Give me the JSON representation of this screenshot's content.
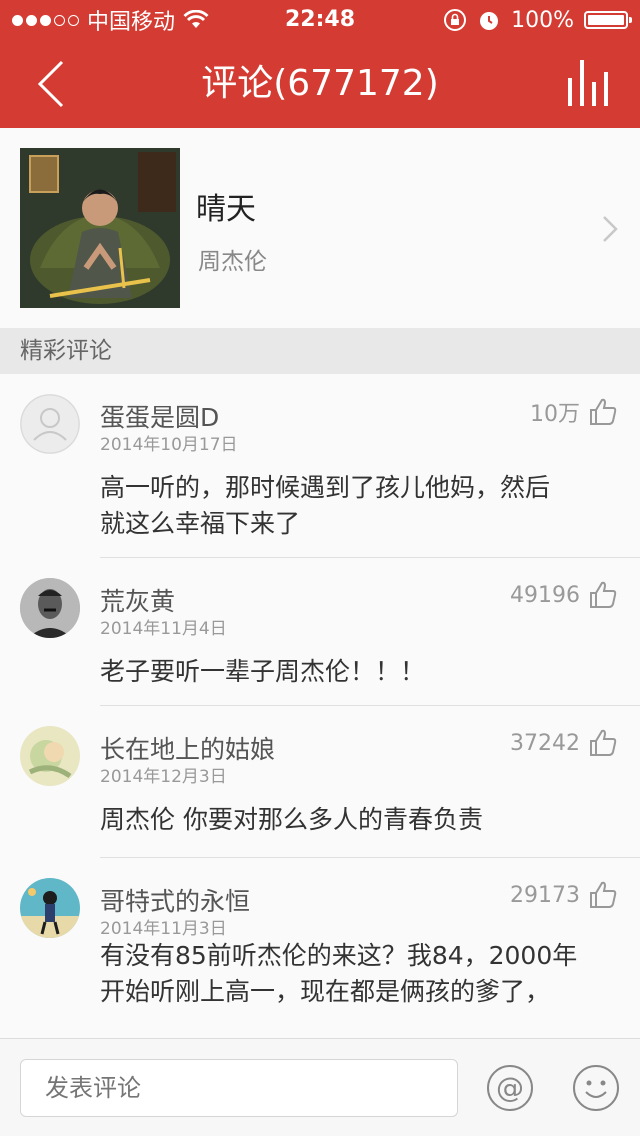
{
  "status_bar": {
    "carrier": "中国移动",
    "time": "22:48",
    "battery": "100%"
  },
  "nav": {
    "title": "评论(677172)"
  },
  "song": {
    "title": "晴天",
    "artist": "周杰伦"
  },
  "section": {
    "title": "精彩评论"
  },
  "comments": [
    {
      "user": "蛋蛋是圆D",
      "date": "2014年10月17日",
      "likes": "10万",
      "text_lines": [
        "高一听的，那时候遇到了孩儿他妈，然后",
        "就这么幸福下来了"
      ]
    },
    {
      "user": "荒灰黄",
      "date": "2014年11月4日",
      "likes": "49196",
      "text_lines": [
        "老子要听一辈子周杰伦！！！"
      ]
    },
    {
      "user": "长在地上的姑娘",
      "date": "2014年12月3日",
      "likes": "37242",
      "text_lines": [
        "周杰伦 你要对那么多人的青春负责"
      ]
    },
    {
      "user": "哥特式的永恒",
      "date": "2014年11月3日",
      "likes": "29173",
      "text_lines": [
        "有没有85前听杰伦的来这？我84，2000年",
        "开始听刚上高一，现在都是俩孩的爹了，"
      ]
    }
  ],
  "input": {
    "placeholder": "发表评论"
  },
  "colors": {
    "accent": "#d43c33"
  }
}
